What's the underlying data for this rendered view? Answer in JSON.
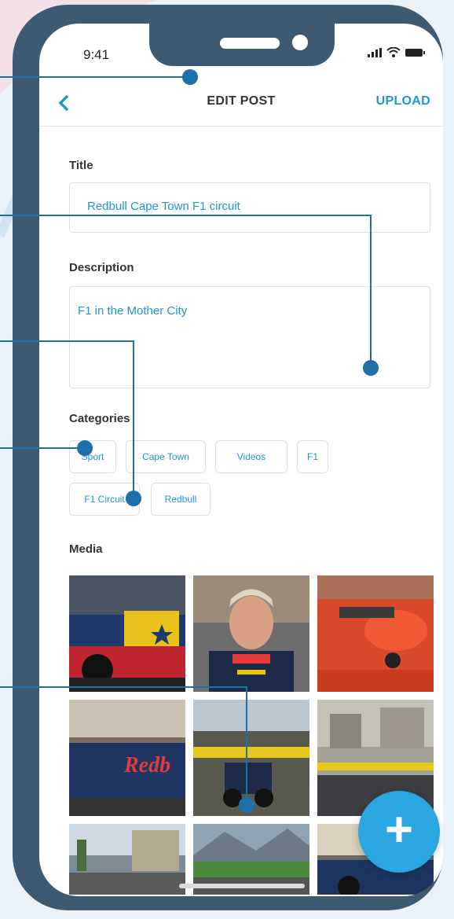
{
  "status_bar": {
    "time": "9:41"
  },
  "header": {
    "title": "EDIT POST",
    "upload_label": "UPLOAD"
  },
  "form": {
    "title_label": "Title",
    "title_value": "Redbull Cape Town F1 circuit",
    "description_label": "Description",
    "description_value": "F1 in the Mother City",
    "categories_label": "Categories",
    "categories": [
      "Sport",
      "Cape Town",
      "Videos",
      "F1",
      "F1 Circuit",
      "Redbull"
    ],
    "media_label": "Media"
  },
  "fab": {
    "symbol": "+"
  },
  "colors": {
    "accent": "#2196d3",
    "frame": "#3d5a70",
    "callout": "#1f6fa8"
  },
  "icons": [
    "back-arrow-icon",
    "signal-icon",
    "wifi-icon",
    "battery-icon",
    "plus-icon"
  ]
}
